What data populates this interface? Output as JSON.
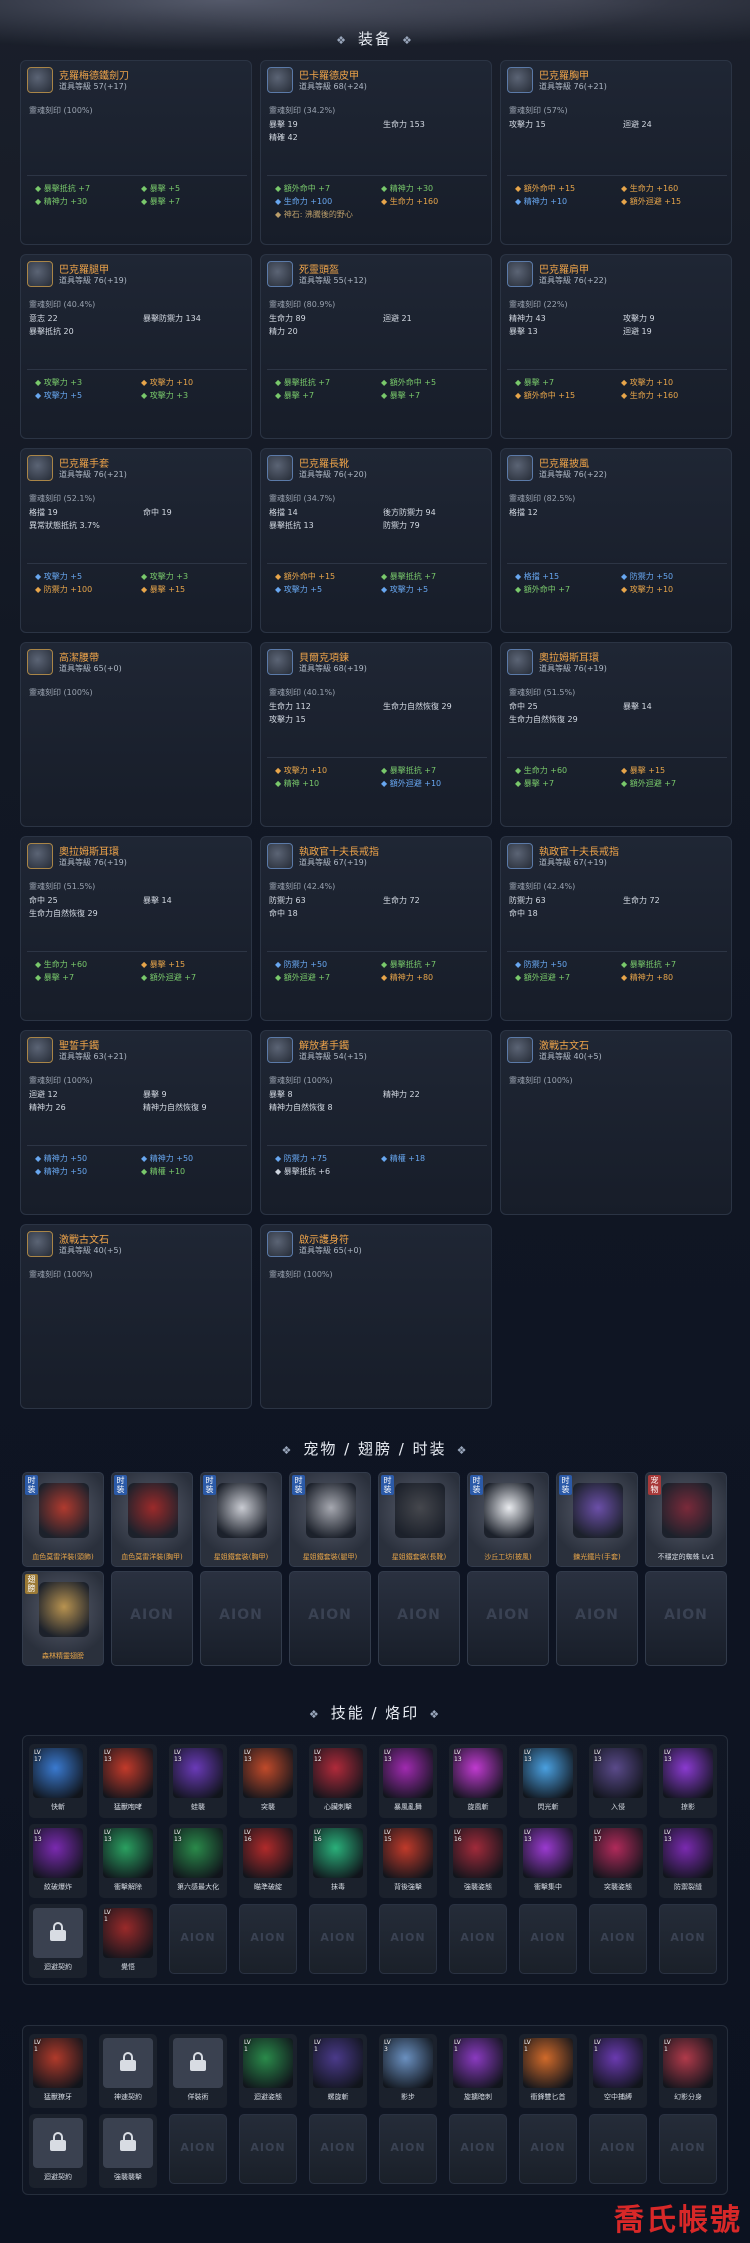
{
  "sections": {
    "equipment": "装备",
    "pets": "宠物 / 翅膀 / 时装",
    "skills": "技能 / 烙印"
  },
  "equipment": [
    {
      "name": "克羅梅德鐵劍刀",
      "level_label": "道具等級",
      "level": "57(+17)",
      "soul": "靈魂刻印 (100%)",
      "stats": [],
      "bonus": [
        [
          "暴擊抵抗 +7",
          "暴擊 +5"
        ],
        [
          "精神力 +30",
          "暴擊 +7"
        ]
      ],
      "bonus_colors": [
        [
          "g",
          "g"
        ],
        [
          "g",
          "g"
        ]
      ]
    },
    {
      "name": "巴卡羅德皮甲",
      "level_label": "道具等級",
      "level": "68(+24)",
      "soul": "靈魂刻印 (34.2%)",
      "stats": [
        [
          "暴擊 19",
          "生命力 153"
        ],
        [
          "精確 42",
          ""
        ]
      ],
      "bonus": [
        [
          "額外命中 +7",
          "精神力 +30"
        ],
        [
          "生命力 +100",
          "生命力 +160"
        ],
        [
          "神石: 沸騰後的野心",
          ""
        ]
      ],
      "bonus_colors": [
        [
          "g",
          "g"
        ],
        [
          "bl",
          "o"
        ],
        [
          "sub",
          ""
        ]
      ]
    },
    {
      "name": "巴克羅胸甲",
      "level_label": "道具等級",
      "level": "76(+21)",
      "soul": "靈魂刻印 (57%)",
      "stats": [
        [
          "攻擊力 15",
          "迴避 24"
        ]
      ],
      "bonus": [
        [
          "額外命中 +15",
          "生命力 +160"
        ],
        [
          "精神力 +10",
          "額外迴避 +15"
        ]
      ],
      "bonus_colors": [
        [
          "o",
          "o"
        ],
        [
          "bl",
          "o"
        ]
      ]
    },
    {
      "name": "巴克羅腿甲",
      "level_label": "道具等級",
      "level": "76(+19)",
      "soul": "靈魂刻印 (40.4%)",
      "stats": [
        [
          "意志 22",
          "暴擊防禦力 134"
        ],
        [
          "暴擊抵抗 20",
          ""
        ]
      ],
      "bonus": [
        [
          "攻擊力 +3",
          "攻擊力 +10"
        ],
        [
          "攻擊力 +5",
          "攻擊力 +3"
        ]
      ],
      "bonus_colors": [
        [
          "g",
          "o"
        ],
        [
          "bl",
          "g"
        ]
      ]
    },
    {
      "name": "死靈頭盔",
      "level_label": "道具等級",
      "level": "55(+12)",
      "soul": "靈魂刻印 (80.9%)",
      "stats": [
        [
          "生命力 89",
          "迴避 21"
        ],
        [
          "精力 20",
          ""
        ]
      ],
      "bonus": [
        [
          "暴擊抵抗 +7",
          "額外命中 +5"
        ],
        [
          "暴擊 +7",
          "暴擊 +7"
        ]
      ],
      "bonus_colors": [
        [
          "g",
          "g"
        ],
        [
          "g",
          "g"
        ]
      ]
    },
    {
      "name": "巴克羅肩甲",
      "level_label": "道具等級",
      "level": "76(+22)",
      "soul": "靈魂刻印 (22%)",
      "stats": [
        [
          "精神力 43",
          "攻擊力 9"
        ],
        [
          "暴擊 13",
          "迴避 19"
        ]
      ],
      "bonus": [
        [
          "暴擊 +7",
          "攻擊力 +10"
        ],
        [
          "額外命中 +15",
          "生命力 +160"
        ]
      ],
      "bonus_colors": [
        [
          "g",
          "o"
        ],
        [
          "o",
          "o"
        ]
      ]
    },
    {
      "name": "巴克羅手套",
      "level_label": "道具等級",
      "level": "76(+21)",
      "soul": "靈魂刻印 (52.1%)",
      "stats": [
        [
          "格擋 19",
          "命中 19"
        ],
        [
          "異常狀態抵抗 3.7%",
          ""
        ]
      ],
      "bonus": [
        [
          "攻擊力 +5",
          "攻擊力 +3"
        ],
        [
          "防禦力 +100",
          "暴擊 +15"
        ]
      ],
      "bonus_colors": [
        [
          "bl",
          "g"
        ],
        [
          "o",
          "o"
        ]
      ]
    },
    {
      "name": "巴克羅長靴",
      "level_label": "道具等級",
      "level": "76(+20)",
      "soul": "靈魂刻印 (34.7%)",
      "stats": [
        [
          "格擋 14",
          "後方防禦力 94"
        ],
        [
          "暴擊抵抗 13",
          "防禦力 79"
        ]
      ],
      "bonus": [
        [
          "額外命中 +15",
          "暴擊抵抗 +7"
        ],
        [
          "攻擊力 +5",
          "攻擊力 +5"
        ]
      ],
      "bonus_colors": [
        [
          "o",
          "g"
        ],
        [
          "bl",
          "bl"
        ]
      ]
    },
    {
      "name": "巴克羅披風",
      "level_label": "道具等級",
      "level": "76(+22)",
      "soul": "靈魂刻印 (82.5%)",
      "stats": [
        [
          "格擋 12",
          ""
        ]
      ],
      "bonus": [
        [
          "格擋 +15",
          "防禦力 +50"
        ],
        [
          "額外命中 +7",
          "攻擊力 +10"
        ]
      ],
      "bonus_colors": [
        [
          "bl",
          "bl"
        ],
        [
          "g",
          "o"
        ]
      ]
    },
    {
      "name": "高潔腰帶",
      "level_label": "道具等級",
      "level": "65(+0)",
      "soul": "靈魂刻印 (100%)",
      "stats": [],
      "bonus": [],
      "bonus_colors": []
    },
    {
      "name": "貝爾克項鍊",
      "level_label": "道具等級",
      "level": "68(+19)",
      "soul": "靈魂刻印 (40.1%)",
      "stats": [
        [
          "生命力 112",
          "生命力自然恢復 29"
        ],
        [
          "攻擊力 15",
          ""
        ]
      ],
      "bonus": [
        [
          "攻擊力 +10",
          "暴擊抵抗 +7"
        ],
        [
          "精神 +10",
          "額外迴避 +10"
        ]
      ],
      "bonus_colors": [
        [
          "o",
          "g"
        ],
        [
          "g",
          "bl"
        ]
      ]
    },
    {
      "name": "奧拉姆斯耳環",
      "level_label": "道具等級",
      "level": "76(+19)",
      "soul": "靈魂刻印 (51.5%)",
      "stats": [
        [
          "命中 25",
          "暴擊 14"
        ],
        [
          "生命力自然恢復 29",
          ""
        ]
      ],
      "bonus": [
        [
          "生命力 +60",
          "暴擊 +15"
        ],
        [
          "暴擊 +7",
          "額外迴避 +7"
        ]
      ],
      "bonus_colors": [
        [
          "g",
          "o"
        ],
        [
          "g",
          "g"
        ]
      ]
    },
    {
      "name": "奧拉姆斯耳環",
      "level_label": "道具等級",
      "level": "76(+19)",
      "soul": "靈魂刻印 (51.5%)",
      "stats": [
        [
          "命中 25",
          "暴擊 14"
        ],
        [
          "生命力自然恢復 29",
          ""
        ]
      ],
      "bonus": [
        [
          "生命力 +60",
          "暴擊 +15"
        ],
        [
          "暴擊 +7",
          "額外迴避 +7"
        ]
      ],
      "bonus_colors": [
        [
          "g",
          "o"
        ],
        [
          "g",
          "g"
        ]
      ]
    },
    {
      "name": "執政官十夫長戒指",
      "level_label": "道具等級",
      "level": "67(+19)",
      "soul": "靈魂刻印 (42.4%)",
      "stats": [
        [
          "防禦力 63",
          "生命力 72"
        ],
        [
          "命中 18",
          ""
        ]
      ],
      "bonus": [
        [
          "防禦力 +50",
          "暴擊抵抗 +7"
        ],
        [
          "額外迴避 +7",
          "精神力 +80"
        ]
      ],
      "bonus_colors": [
        [
          "bl",
          "g"
        ],
        [
          "g",
          "o"
        ]
      ]
    },
    {
      "name": "執政官十夫長戒指",
      "level_label": "道具等級",
      "level": "67(+19)",
      "soul": "靈魂刻印 (42.4%)",
      "stats": [
        [
          "防禦力 63",
          "生命力 72"
        ],
        [
          "命中 18",
          ""
        ]
      ],
      "bonus": [
        [
          "防禦力 +50",
          "暴擊抵抗 +7"
        ],
        [
          "額外迴避 +7",
          "精神力 +80"
        ]
      ],
      "bonus_colors": [
        [
          "bl",
          "g"
        ],
        [
          "g",
          "o"
        ]
      ]
    },
    {
      "name": "聖誓手鐲",
      "level_label": "道具等級",
      "level": "63(+21)",
      "soul": "靈魂刻印 (100%)",
      "stats": [
        [
          "迴避 12",
          "暴擊 9"
        ],
        [
          "精神力 26",
          "精神力自然恢復 9"
        ]
      ],
      "bonus": [
        [
          "精神力 +50",
          "精神力 +50"
        ],
        [
          "精神力 +50",
          "精權 +10"
        ]
      ],
      "bonus_colors": [
        [
          "bl",
          "bl"
        ],
        [
          "bl",
          "g"
        ]
      ]
    },
    {
      "name": "解放者手鐲",
      "level_label": "道具等級",
      "level": "54(+15)",
      "soul": "靈魂刻印 (100%)",
      "stats": [
        [
          "暴擊 8",
          "精神力 22"
        ],
        [
          "精神力自然恢復 8",
          ""
        ]
      ],
      "bonus": [
        [
          "防禦力 +75",
          "精權 +18"
        ],
        [
          "暴擊抵抗 +6",
          ""
        ]
      ],
      "bonus_colors": [
        [
          "bl",
          "bl"
        ],
        [
          "w",
          ""
        ]
      ]
    },
    {
      "name": "激戰古文石",
      "level_label": "道具等級",
      "level": "40(+5)",
      "soul": "靈魂刻印 (100%)",
      "stats": [],
      "bonus": [],
      "bonus_colors": []
    },
    {
      "name": "激戰古文石",
      "level_label": "道具等級",
      "level": "40(+5)",
      "soul": "靈魂刻印 (100%)",
      "stats": [],
      "bonus": [],
      "bonus_colors": []
    },
    {
      "name": "啟示護身符",
      "level_label": "道具等級",
      "level": "65(+0)",
      "soul": "靈魂刻印 (100%)",
      "stats": [],
      "bonus": [],
      "bonus_colors": []
    }
  ],
  "pets": [
    {
      "tag": "时装",
      "label": "血色莫雷洋裝(頭飾)",
      "filled": true,
      "color": "#b03a2e",
      "tag_style": "blue",
      "label_style": "o"
    },
    {
      "tag": "时装",
      "label": "血色莫雷洋裝(胸甲)",
      "filled": true,
      "color": "#9b2a2a",
      "tag_style": "blue",
      "label_style": "o"
    },
    {
      "tag": "时装",
      "label": "星姐鐵套裝(胸甲)",
      "filled": true,
      "color": "#c9cbd2",
      "tag_style": "blue",
      "label_style": "o"
    },
    {
      "tag": "时装",
      "label": "星姐鐵套裝(腿甲)",
      "filled": true,
      "color": "#a6a8b0",
      "tag_style": "blue",
      "label_style": "o"
    },
    {
      "tag": "时装",
      "label": "星姐鐵套裝(長靴)",
      "filled": true,
      "color": "#45474d",
      "tag_style": "blue",
      "label_style": "o"
    },
    {
      "tag": "时装",
      "label": "沙丘工坊(披風)",
      "filled": true,
      "color": "#e9ebef",
      "tag_style": "blue",
      "label_style": "o"
    },
    {
      "tag": "时装",
      "label": "鍊光鐵片(手套)",
      "filled": true,
      "color": "#6b4fa8",
      "tag_style": "blue",
      "label_style": "o"
    },
    {
      "tag": "宠物",
      "label": "不穩定的蜘蛛 Lv1",
      "filled": true,
      "color": "#7a2a3a",
      "tag_style": "red",
      "label_style": "w"
    },
    {
      "tag": "翅膀",
      "label": "森林精靈翅膀",
      "filled": true,
      "color": "#b89350",
      "tag_style": "gold",
      "label_style": "o"
    },
    {
      "tag": "",
      "label": "",
      "filled": false
    },
    {
      "tag": "",
      "label": "",
      "filled": false
    },
    {
      "tag": "",
      "label": "",
      "filled": false
    },
    {
      "tag": "",
      "label": "",
      "filled": false
    },
    {
      "tag": "",
      "label": "",
      "filled": false
    },
    {
      "tag": "",
      "label": "",
      "filled": false
    },
    {
      "tag": "",
      "label": "",
      "filled": false
    }
  ],
  "empty_logo": "AION",
  "skills_a": [
    {
      "lv": "LV 17",
      "name": "快斬",
      "color": "#3a7ad0"
    },
    {
      "lv": "LV 13",
      "name": "猛獸咆哮",
      "color": "#c23a2a"
    },
    {
      "lv": "LV 13",
      "name": "蛙襲",
      "color": "#6a3ab8"
    },
    {
      "lv": "LV 13",
      "name": "突襲",
      "color": "#c04a2a"
    },
    {
      "lv": "LV 12",
      "name": "心臟刺擊",
      "color": "#b02a3a"
    },
    {
      "lv": "LV 13",
      "name": "暴風亂舞",
      "color": "#a02ab0"
    },
    {
      "lv": "LV 13",
      "name": "旋風斬",
      "color": "#c03ad0"
    },
    {
      "lv": "LV 13",
      "name": "閃光斬",
      "color": "#4aa0e0"
    },
    {
      "lv": "LV 13",
      "name": "入侵",
      "color": "#5a4a8a"
    },
    {
      "lv": "LV 13",
      "name": "掠影",
      "color": "#8a3ad0"
    },
    {
      "lv": "LV 13",
      "name": "紋破爆炸",
      "color": "#7a2ab0"
    },
    {
      "lv": "LV 13",
      "name": "衝擊解除",
      "color": "#2aa060"
    },
    {
      "lv": "LV 13",
      "name": "第六感最大化",
      "color": "#2a8a4a"
    },
    {
      "lv": "LV 16",
      "name": "瞄準破綻",
      "color": "#b02a2a"
    },
    {
      "lv": "LV 16",
      "name": "抹毒",
      "color": "#2ab07a"
    },
    {
      "lv": "LV 15",
      "name": "背後強擊",
      "color": "#c03a2a"
    },
    {
      "lv": "LV 16",
      "name": "強襲姿態",
      "color": "#a02a3a"
    },
    {
      "lv": "LV 13",
      "name": "衝擊集中",
      "color": "#9a3ad0"
    },
    {
      "lv": "LV 17",
      "name": "突襲姿態",
      "color": "#b02a5a"
    },
    {
      "lv": "LV 13",
      "name": "防禦裂縫",
      "color": "#7a2ab0"
    },
    {
      "lv": "",
      "name": "迴避契約",
      "locked": true
    },
    {
      "lv": "LV 1",
      "name": "覺悟",
      "color": "#9a2a2a"
    },
    {
      "empty": true
    },
    {
      "empty": true
    },
    {
      "empty": true
    },
    {
      "empty": true
    },
    {
      "empty": true
    },
    {
      "empty": true
    },
    {
      "empty": true
    },
    {
      "empty": true
    }
  ],
  "skills_b": [
    {
      "lv": "LV 1",
      "name": "猛獸獠牙",
      "color": "#b03a2a"
    },
    {
      "lv": "",
      "name": "神速契約",
      "locked": true
    },
    {
      "lv": "",
      "name": "佯裝術",
      "locked": true
    },
    {
      "lv": "LV 1",
      "name": "迴避姿態",
      "color": "#2a8a4a"
    },
    {
      "lv": "LV 1",
      "name": "螺旋斬",
      "color": "#4a3a8a"
    },
    {
      "lv": "LV 3",
      "name": "影步",
      "color": "#6a90c0"
    },
    {
      "lv": "LV 1",
      "name": "旋擴暗刺",
      "color": "#8a3ac0"
    },
    {
      "lv": "LV 1",
      "name": "衝鋒雙匕首",
      "color": "#d06a2a"
    },
    {
      "lv": "LV 1",
      "name": "空中捕縛",
      "color": "#6a3ab0"
    },
    {
      "lv": "LV 1",
      "name": "幻影分身",
      "color": "#b03a4a"
    },
    {
      "lv": "",
      "name": "迴避契約",
      "locked": true
    },
    {
      "lv": "",
      "name": "強襲襲擊",
      "locked": true
    },
    {
      "empty": true
    },
    {
      "empty": true
    },
    {
      "empty": true
    },
    {
      "empty": true
    },
    {
      "empty": true
    },
    {
      "empty": true
    },
    {
      "empty": true
    },
    {
      "empty": true
    }
  ],
  "watermark": "喬氏帳號"
}
